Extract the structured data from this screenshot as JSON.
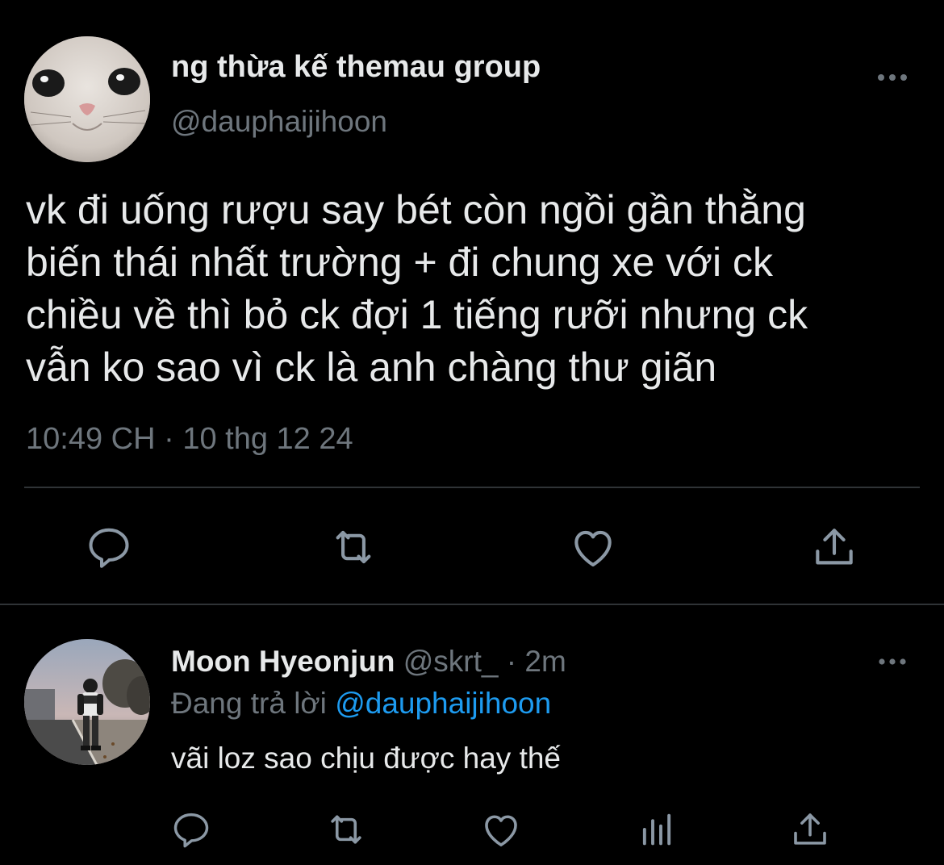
{
  "tweet": {
    "author": {
      "display_name": "ng thừa kế themau group",
      "handle": "@dauphaijihoon",
      "avatar": "cat-avatar"
    },
    "body": "vk đi uống rượu say bét còn ngồi gần thằng\nbiến thái nhất trường + đi chung xe với ck\nchiều về thì bỏ ck đợi 1 tiếng rưỡi nhưng ck\nvẫn ko sao vì ck là anh chàng thư giãn",
    "timestamp": "10:49 CH",
    "separator": "·",
    "date": "10 thg 12 24",
    "actions": [
      "reply-icon",
      "retweet-icon",
      "like-icon",
      "share-icon"
    ],
    "more_icon": "more-icon"
  },
  "reply": {
    "author": {
      "display_name": "Moon Hyeonjun",
      "handle": "@skrt_",
      "avatar": "person-street-avatar"
    },
    "separator": "·",
    "age": "2m",
    "replying_prefix": "Đang trả lời",
    "replying_to": "@dauphaijihoon",
    "text": "vãi loz sao chịu được hay thế",
    "actions": [
      "reply-icon",
      "retweet-icon",
      "like-icon",
      "views-icon",
      "share-icon"
    ],
    "more_icon": "more-icon"
  },
  "colors": {
    "background": "#000000",
    "text_primary": "#e7e9ea",
    "text_secondary": "#6e767d",
    "link": "#1d9bf0",
    "divider": "#2f3336"
  }
}
